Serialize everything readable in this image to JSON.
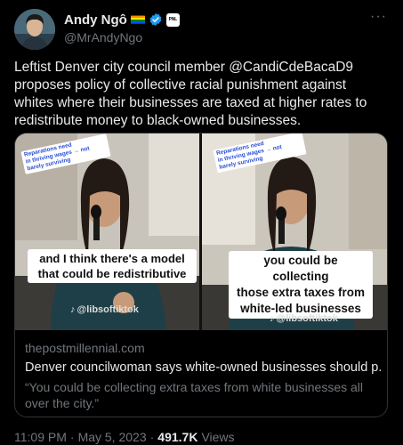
{
  "author": {
    "display_name": "Andy Ngô",
    "handle": "@MrAndyNgo",
    "affiliation_badge": "PNL"
  },
  "icons": {
    "flag": "rainbow-flag-icon",
    "verified": "verified-badge-icon",
    "more": "more-options-icon",
    "watermark": "tiktok-icon"
  },
  "colors": {
    "background": "#000000",
    "text": "#e7e9ea",
    "secondary": "#71767b",
    "verified": "#1d9bf0",
    "border": "#2f3336"
  },
  "tweet": {
    "text": "Leftist Denver city council member @CandiCdeBacaD9 proposes policy of collective racial punishment against whites where their businesses are taxed at higher rates to redistribute money to black-owned businesses."
  },
  "media": {
    "left": {
      "sticker": "Reparations need\nin thriving wages → not\nbarely surviving",
      "caption": "and I think there's a model\nthat could be redistributive",
      "watermark": "@libsoftiktok"
    },
    "right": {
      "sticker": "Reparations need\nin thriving wages → not\nbarely surviving",
      "caption": "you could be collecting\nthose extra taxes from\nwhite-led businesses",
      "watermark": "@libsoftiktok"
    }
  },
  "link_card": {
    "domain": "thepostmillennial.com",
    "title": "Denver councilwoman says white-owned businesses should p...",
    "description": "“You could be collecting extra taxes from white businesses all over the city.”"
  },
  "meta": {
    "time": "11:09 PM",
    "separator": "·",
    "date": "May 5, 2023",
    "views_count": "491.7K",
    "views_label": "Views"
  }
}
